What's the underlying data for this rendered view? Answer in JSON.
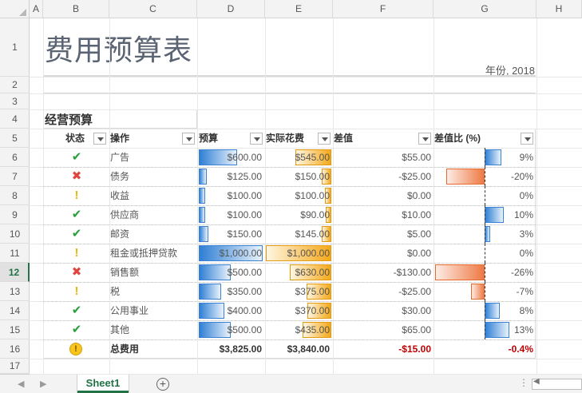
{
  "columns": [
    "A",
    "B",
    "C",
    "D",
    "E",
    "F",
    "G",
    "H"
  ],
  "rows": [
    "1",
    "2",
    "3",
    "4",
    "5",
    "6",
    "7",
    "8",
    "9",
    "10",
    "11",
    "12",
    "13",
    "14",
    "15",
    "16",
    "17"
  ],
  "selected_row": "12",
  "title": "费用预算表",
  "year_label": "年份, 2018",
  "section_title": "经营预算",
  "headers": {
    "status": "状态",
    "operation": "操作",
    "budget": "预算",
    "actual": "实际花费",
    "diff": "差值",
    "diff_pct": "差值比 (%)"
  },
  "items": [
    {
      "status": "check",
      "name": "广告",
      "budget": "$600.00",
      "actual": "$545.00",
      "diff": "$55.00",
      "pct": "9%",
      "budget_value": 600,
      "actual_value": 545,
      "pct_value": 9
    },
    {
      "status": "x",
      "name": "债务",
      "budget": "$125.00",
      "actual": "$150.00",
      "diff": "-$25.00",
      "pct": "-20%",
      "budget_value": 125,
      "actual_value": 150,
      "pct_value": -20
    },
    {
      "status": "warn",
      "name": "收益",
      "budget": "$100.00",
      "actual": "$100.00",
      "diff": "$0.00",
      "pct": "0%",
      "budget_value": 100,
      "actual_value": 100,
      "pct_value": 0
    },
    {
      "status": "check",
      "name": "供应商",
      "budget": "$100.00",
      "actual": "$90.00",
      "diff": "$10.00",
      "pct": "10%",
      "budget_value": 100,
      "actual_value": 90,
      "pct_value": 10
    },
    {
      "status": "check",
      "name": "邮资",
      "budget": "$150.00",
      "actual": "$145.00",
      "diff": "$5.00",
      "pct": "3%",
      "budget_value": 150,
      "actual_value": 145,
      "pct_value": 3
    },
    {
      "status": "warn",
      "name": "租金或抵押贷款",
      "budget": "$1,000.00",
      "actual": "$1,000.00",
      "diff": "$0.00",
      "pct": "0%",
      "budget_value": 1000,
      "actual_value": 1000,
      "pct_value": 0
    },
    {
      "status": "x",
      "name": "销售额",
      "budget": "$500.00",
      "actual": "$630.00",
      "diff": "-$130.00",
      "pct": "-26%",
      "budget_value": 500,
      "actual_value": 630,
      "pct_value": -26
    },
    {
      "status": "warn",
      "name": "税",
      "budget": "$350.00",
      "actual": "$375.00",
      "diff": "-$25.00",
      "pct": "-7%",
      "budget_value": 350,
      "actual_value": 375,
      "pct_value": -7
    },
    {
      "status": "check",
      "name": "公用事业",
      "budget": "$400.00",
      "actual": "$370.00",
      "diff": "$30.00",
      "pct": "8%",
      "budget_value": 400,
      "actual_value": 370,
      "pct_value": 8
    },
    {
      "status": "check",
      "name": "其他",
      "budget": "$500.00",
      "actual": "$435.00",
      "diff": "$65.00",
      "pct": "13%",
      "budget_value": 500,
      "actual_value": 435,
      "pct_value": 13
    }
  ],
  "total": {
    "status": "circle-warn",
    "name": "总费用",
    "budget": "$3,825.00",
    "actual": "$3,840.00",
    "diff": "-$15.00",
    "pct": "-0.4%"
  },
  "sheet_tab": "Sheet1",
  "colors": {
    "accent": "#217346",
    "positive_bar": "#2f7fd4",
    "actual_bar": "#f5a81a",
    "negative_bar": "#ee7a45",
    "negative_text": "#c00000"
  }
}
